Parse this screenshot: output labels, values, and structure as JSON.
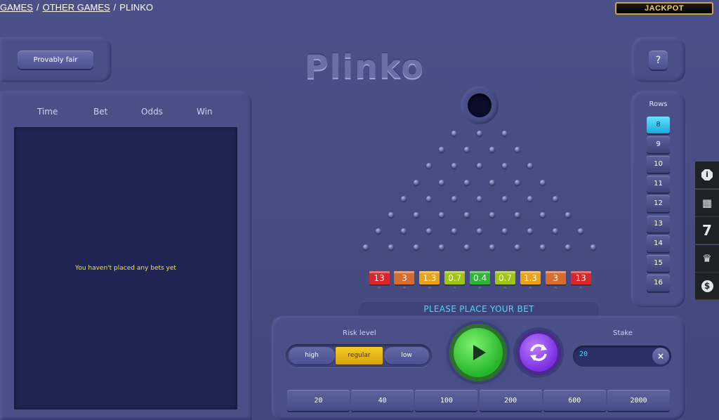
{
  "breadcrumb": {
    "games": "GAMES",
    "other": "OTHER GAMES",
    "current": "PLINKO",
    "sep": "/"
  },
  "jackpot": {
    "label": "JACKPOT"
  },
  "provably_fair": {
    "label": "Provably fair"
  },
  "logo": {
    "text": "Plinko"
  },
  "help": {
    "label": "?"
  },
  "history": {
    "columns": [
      "Time",
      "Bet",
      "Odds",
      "Win"
    ],
    "empty_message": "You haven't placed any bets yet"
  },
  "board": {
    "row_count": 8,
    "buckets": [
      {
        "value": "13",
        "color": "#d8262b"
      },
      {
        "value": "3",
        "color": "#d66c2d"
      },
      {
        "value": "1.3",
        "color": "#e8a31b"
      },
      {
        "value": "0.7",
        "color": "#9ec414"
      },
      {
        "value": "0.4",
        "color": "#2fb53a"
      },
      {
        "value": "0.7",
        "color": "#9ec414"
      },
      {
        "value": "1.3",
        "color": "#e8a31b"
      },
      {
        "value": "3",
        "color": "#d66c2d"
      },
      {
        "value": "13",
        "color": "#d8262b"
      }
    ],
    "status": "PLEASE PLACE YOUR BET"
  },
  "rows": {
    "label": "Rows",
    "options": [
      "8",
      "9",
      "10",
      "11",
      "12",
      "13",
      "14",
      "15",
      "16"
    ],
    "selected": "8"
  },
  "side_menu": [
    {
      "icon": "info-icon",
      "glyph": "i"
    },
    {
      "icon": "gift-icon",
      "glyph": "▦"
    },
    {
      "icon": "seven-icon",
      "glyph": "7"
    },
    {
      "icon": "trophy-icon",
      "glyph": "♛"
    },
    {
      "icon": "dollar-icon",
      "glyph": "$"
    }
  ],
  "risk": {
    "label": "Risk level",
    "options": [
      "high",
      "regular",
      "low"
    ],
    "selected": "regular"
  },
  "stake": {
    "label": "Stake",
    "value": "20",
    "clear": "×"
  },
  "quick_stakes": [
    "20",
    "40",
    "100",
    "200",
    "600",
    "2000"
  ],
  "colors": {
    "accent_cyan": "#4ed7f5",
    "risk_selected": "#f4cc24",
    "play_green": "#27b52a",
    "auto_purple": "#7a2fe0"
  }
}
